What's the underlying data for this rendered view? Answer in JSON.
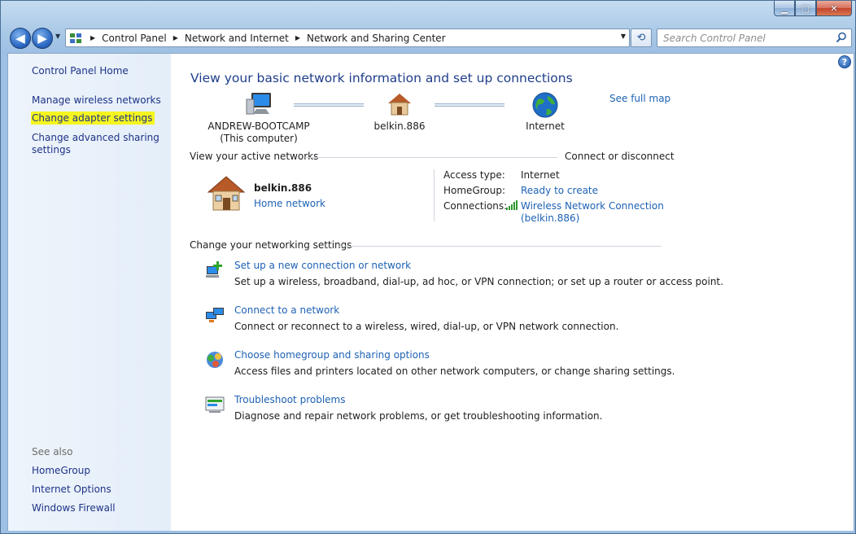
{
  "window": {
    "caption_min": "▁",
    "caption_max": "▢",
    "caption_close": "✕"
  },
  "nav": {
    "back_icon": "◀",
    "forward_icon": "▶",
    "breadcrumbs": [
      "Control Panel",
      "Network and Internet",
      "Network and Sharing Center"
    ],
    "search_placeholder": "Search Control Panel"
  },
  "left_pane": {
    "home": "Control Panel Home",
    "links": [
      "Manage wireless networks",
      "Change adapter settings",
      "Change advanced sharing settings"
    ],
    "advanced_line1": "Change advanced sharing",
    "advanced_line2": "settings",
    "see_also_title": "See also",
    "see_also": [
      "HomeGroup",
      "Internet Options",
      "Windows Firewall"
    ]
  },
  "main": {
    "help": "?",
    "title": "View your basic network information and set up connections",
    "see_full_map": "See full map",
    "map": {
      "computer_name": "ANDREW-BOOTCAMP",
      "computer_sub": "(This computer)",
      "router": "belkin.886",
      "internet": "Internet"
    },
    "active": {
      "title": "View your active networks",
      "connect_link": "Connect or disconnect",
      "network_name": "belkin.886",
      "network_type": "Home network",
      "access_type_label": "Access type:",
      "access_type_value": "Internet",
      "homegroup_label": "HomeGroup:",
      "homegroup_value": "Ready to create",
      "connections_label": "Connections:",
      "connection_line1": "Wireless Network Connection",
      "connection_line2": "(belkin.886)"
    },
    "settings": {
      "title": "Change your networking settings",
      "tasks": [
        {
          "title": "Set up a new connection or network",
          "desc": "Set up a wireless, broadband, dial-up, ad hoc, or VPN connection; or set up a router or access point."
        },
        {
          "title": "Connect to a network",
          "desc": "Connect or reconnect to a wireless, wired, dial-up, or VPN network connection."
        },
        {
          "title": "Choose homegroup and sharing options",
          "desc": "Access files and printers located on other network computers, or change sharing settings."
        },
        {
          "title": "Troubleshoot problems",
          "desc": "Diagnose and repair network problems, or get troubleshooting information."
        }
      ]
    }
  },
  "colors": {
    "link": "#1e62b4",
    "heading": "#1e3d8a",
    "highlight": "#f5f520"
  },
  "icons": [
    "search-icon",
    "computer-icon",
    "house-icon",
    "globe-icon",
    "signal-bars-icon",
    "network-setup-icon",
    "connect-network-icon",
    "homegroup-icon",
    "troubleshoot-icon",
    "help-icon"
  ]
}
